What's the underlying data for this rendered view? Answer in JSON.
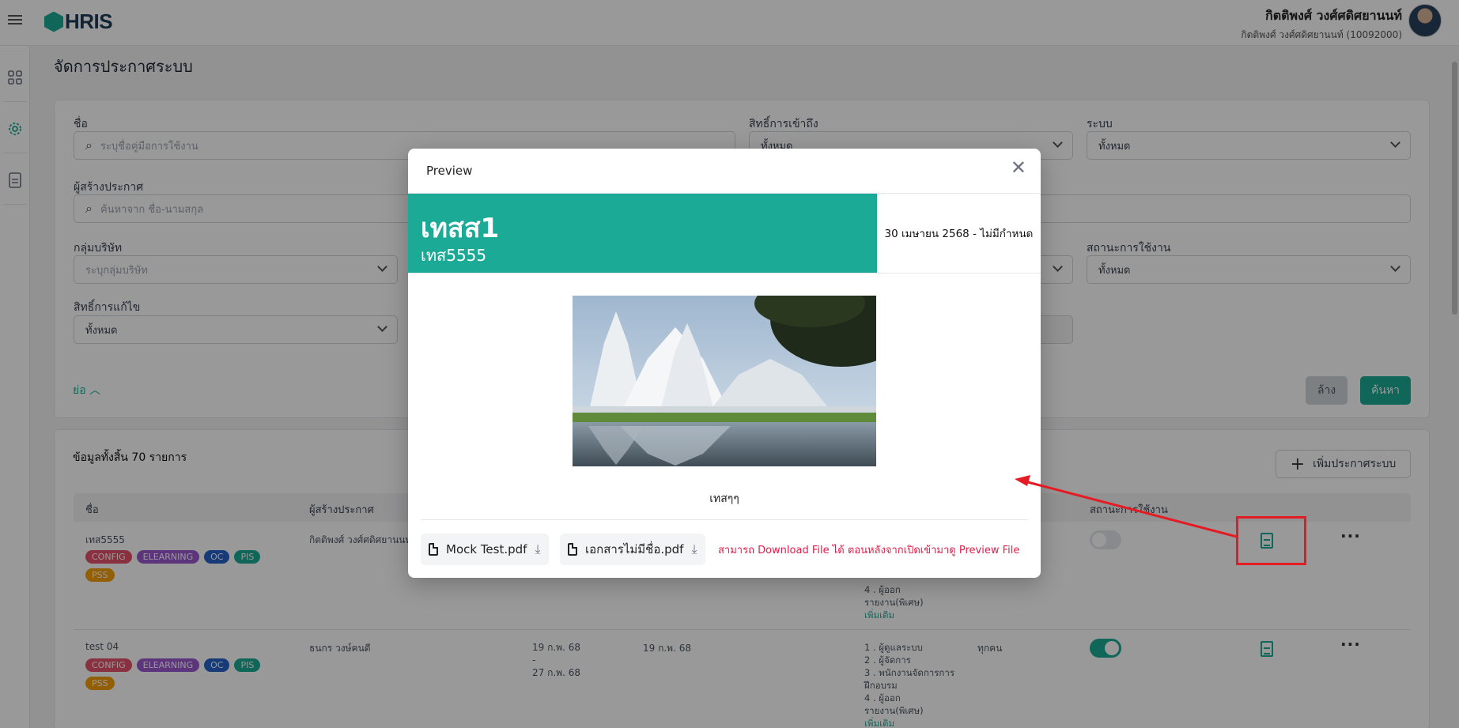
{
  "app": {
    "logo_text": "HRIS",
    "brand_color": "#1aaa95"
  },
  "user": {
    "name": "กิตติพงศ์ วงศ์ศดิศยานนท์",
    "sub": "กิตติพงศ์ วงศ์ศดิศยานนท์ (10092000)"
  },
  "page": {
    "title": "จัดการประกาศระบบ"
  },
  "filters": {
    "name_label": "ชื่อ",
    "name_placeholder": "ระบุชื่อคู่มือการใช้งาน",
    "access_label": "สิทธิ์การเข้าถึง",
    "access_value": "ทั้งหมด",
    "system_label": "ระบบ",
    "system_value": "ทั้งหมด",
    "creator_label": "ผู้สร้างประกาศ",
    "creator_placeholder": "ค้นหาจาก ชื่อ-นามสกุล",
    "company_label": "กลุ่มบริษัท",
    "company_placeholder": "ระบุกลุ่มบริษัท",
    "status_label": "สถานะการใช้งาน",
    "status_value": "ทั้งหมด",
    "edit_label": "สิทธิ์การแก้ไข",
    "edit_value": "ทั้งหมด",
    "collapse_label": "ย่อ",
    "clear_label": "ล้าง",
    "search_label": "ค้นหา"
  },
  "table": {
    "total_text": "ข้อมูลทั้งสิ้น 70 รายการ",
    "add_label": "เพิ่มประกาศระบบ",
    "headers": {
      "name": "ชื่อ",
      "creator": "ผู้สร้างประกาศ",
      "status": "สถานะการใช้งาน"
    },
    "rows": [
      {
        "name": "เทส5555",
        "tags": [
          "CONFIG",
          "ELEARNING",
          "OC",
          "PIS",
          "PSS"
        ],
        "creator": "กิตติพงศ์ วงศ์ศดิศยานนท์",
        "approvers_tail": [
          "4 . ผู้ออก",
          "รายงาน(พิเศษ)"
        ],
        "more": "เพิ่มเติม",
        "active": false
      },
      {
        "name": "test 04",
        "tags": [
          "CONFIG",
          "ELEARNING",
          "OC",
          "PIS",
          "PSS"
        ],
        "creator": "ธนกร วงษ์คนดี",
        "date_range": [
          "19 ก.พ. 68",
          "-",
          "27 ก.พ. 68"
        ],
        "date2": "19 ก.พ. 68",
        "approvers": [
          "1 . ผู้ดูแลระบบ",
          "2 . ผู้จัดการ",
          "3 . พนักงานจัดการการ",
          "ฝึกอบรม",
          "4 . ผู้ออก",
          "รายงาน(พิเศษ)"
        ],
        "more": "เพิ่มเติม",
        "audience": "ทุกคน",
        "active": true
      }
    ],
    "tag_colors": {
      "CONFIG": "#e5536b",
      "ELEARNING": "#9b59d0",
      "OC": "#2563c9",
      "PIS": "#1aaa95",
      "PSS": "#f59e0b"
    }
  },
  "modal": {
    "title": "Preview",
    "banner_title": "เทสส1",
    "banner_sub": "เทส5555",
    "date_text": "30 เมษายน 2568 - ไม่มีกำหนด",
    "caption": "เทสๆๆ",
    "files": [
      "Mock Test.pdf",
      "เอกสารไม่มีชื่อ.pdf"
    ],
    "note": "สามารถ Download File ได้ ตอนหลังจากเปิดเข้ามาดู Preview File"
  }
}
